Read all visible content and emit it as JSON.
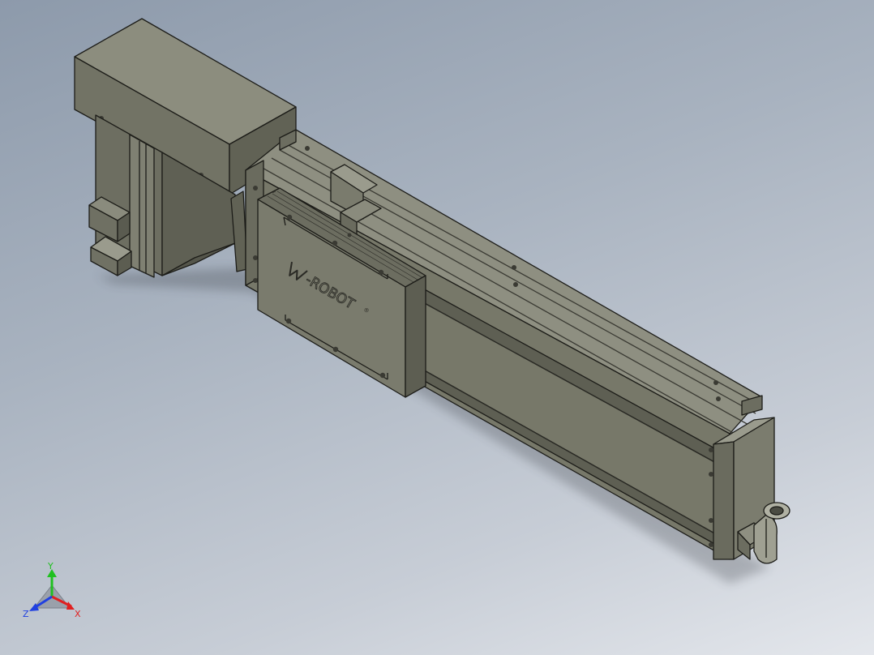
{
  "model": {
    "brand_text": "-ROBOT",
    "registered_mark": "®",
    "body_color": "#77786a",
    "body_dark": "#5e5f53",
    "body_light": "#8d8e80",
    "edge_color": "#1c1c18"
  },
  "triad": {
    "x_label": "X",
    "y_label": "Y",
    "z_label": "Z",
    "x_color": "#e02020",
    "y_color": "#20c020",
    "z_color": "#2040e0"
  }
}
